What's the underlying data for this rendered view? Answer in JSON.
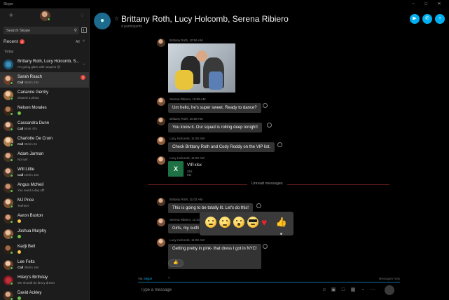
{
  "app": {
    "title": "Skype"
  },
  "search": {
    "placeholder": "Search Skype"
  },
  "recent": {
    "label": "Recent",
    "badge": "3",
    "filter": "All"
  },
  "today_label": "Today",
  "contacts": [
    {
      "name": "Brittany Roth, Lucy Holcomb, S...",
      "sub": "I'm going glam with sequins 😄",
      "kind": "group"
    },
    {
      "name": "Sarah Roach",
      "sub_bold": "Call",
      "sub": "26min 23s",
      "unread": "3",
      "selected": true
    },
    {
      "name": "Carianne Gentry",
      "sub": "Shared a photo"
    },
    {
      "name": "Nelson Morales",
      "sub": ""
    },
    {
      "name": "Cassandra Dunn",
      "sub_bold": "Call",
      "sub": "5min 47s"
    },
    {
      "name": "Charlotte De Crum",
      "sub_bold": "Call",
      "sub": "26min 3s"
    },
    {
      "name": "Adam Jarman",
      "sub": "Not yet"
    },
    {
      "name": "Will Little",
      "sub_bold": "Call",
      "sub": "10min 32s"
    },
    {
      "name": "Angus McNeil",
      "sub": "You need a day off!"
    },
    {
      "name": "MJ Price",
      "sub": "Teehee!"
    },
    {
      "name": "Aaron Buxton",
      "sub": ""
    },
    {
      "name": "Joshua Murphy",
      "sub": ""
    },
    {
      "name": "Kadji Bell",
      "sub": ""
    },
    {
      "name": "Lee Felts",
      "sub_bold": "Call",
      "sub": "26min 16s"
    },
    {
      "name": "Hilary's Birthday",
      "sub": "We should do fancy dress!"
    },
    {
      "name": "David Ackley",
      "sub": ""
    }
  ],
  "chat": {
    "title": "Brittany Roth, Lucy Holcomb, Serena Ribiero",
    "participants": "4 participants"
  },
  "messages": [
    {
      "meta": "Brittany Roth, 10:56 AM",
      "type": "photo"
    },
    {
      "meta": "Serena Ribiero, 10:58 AM",
      "text": "Um hello, he's super sweet. Ready to dance?"
    },
    {
      "meta": "Brittany Roth, 10:59 AM",
      "text": "You know it. Our squad is rolling deep tonight!"
    },
    {
      "meta": "Lucy Holcomb, 11:00 AM",
      "text": "Check Brittany Roth and Cody Roddy on the VIP list."
    },
    {
      "meta": "Lucy Holcomb, 11:00 AM",
      "type": "file",
      "file_name": "VIP.xlsx",
      "file_size": "252 KB",
      "file_glyph": "X"
    },
    {
      "meta": "Brittany Roth, 11:02 AM",
      "text": "This is going to be totally lit. Let's do this!"
    },
    {
      "meta": "Serena Ribiero, 11:02 AM",
      "text": "Girls, my outfit"
    },
    {
      "meta": "Lucy Holcomb, 11:03 AM",
      "text": "Getting pretty in pink- that dress I got in NYC!"
    }
  ],
  "unread_label": "Unread messages",
  "composer": {
    "via_prefix": "Via",
    "via_link": "Skype",
    "right_hint": "Messages help",
    "placeholder": "Type a message"
  },
  "colors": {
    "accent": "#00aff0",
    "bubble": "#333333",
    "sidebar": "#1c1c1c",
    "status_online": "#6cc24a",
    "badge_red": "#e8433a"
  },
  "icons": {
    "header": [
      "video-call-icon",
      "audio-call-icon",
      "add-participant-icon"
    ],
    "composer": [
      "emoticon-icon",
      "image-icon",
      "file-icon",
      "contact-card-icon",
      "more-icon",
      "send-icon"
    ],
    "reactions": [
      "cheeky-emoji",
      "cry-emoji",
      "surprised-emoji",
      "cool-emoji",
      "heart",
      "thumbs-up"
    ]
  }
}
